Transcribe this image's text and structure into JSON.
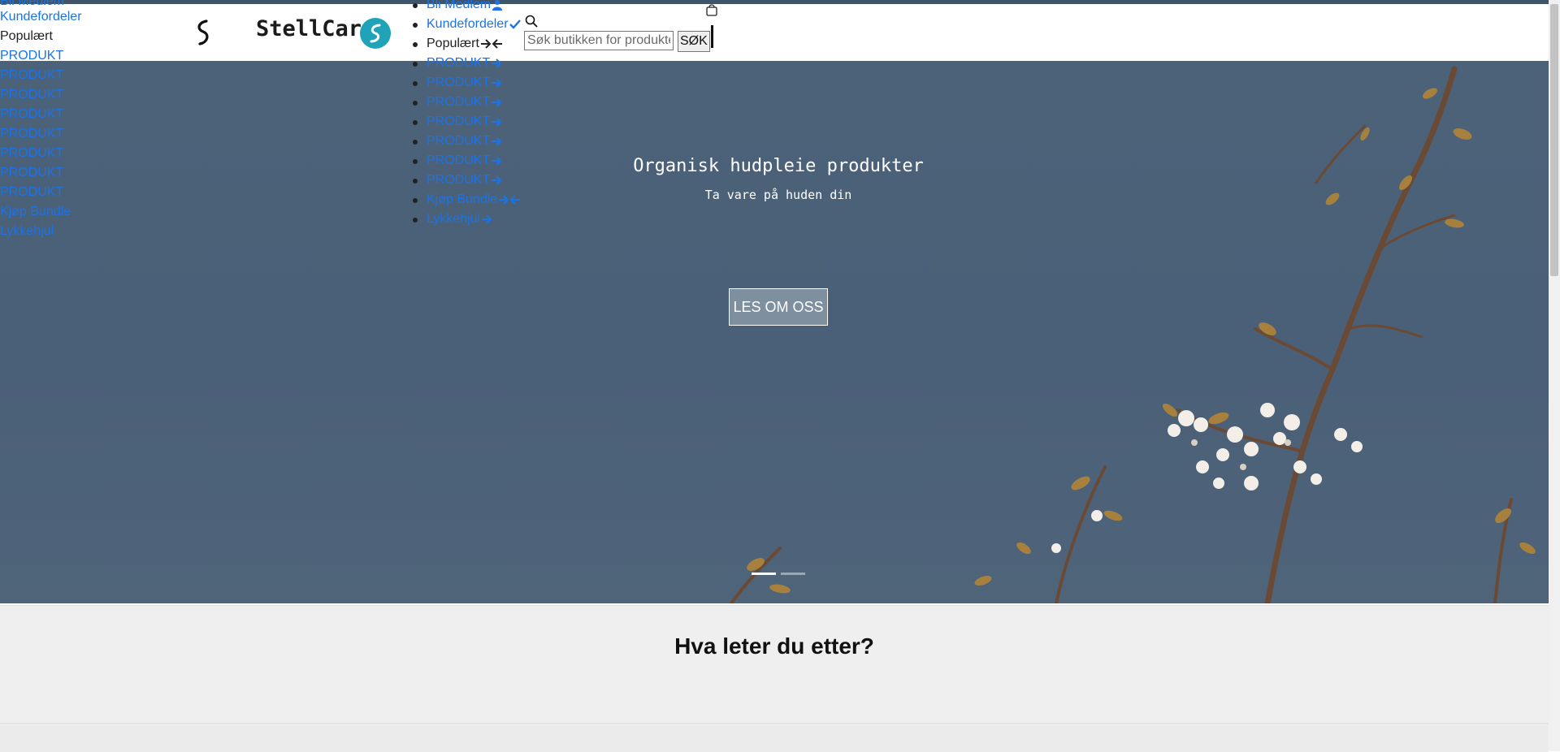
{
  "brand": {
    "name": "StellCare"
  },
  "left_links": [
    {
      "label": "Bli Medlem"
    },
    {
      "label": "Kundefordeler"
    },
    {
      "label": "Populært"
    },
    {
      "label": "PRODUKT"
    },
    {
      "label": "PRODUKT"
    },
    {
      "label": "PRODUKT"
    },
    {
      "label": "PRODUKT"
    },
    {
      "label": "PRODUKT"
    },
    {
      "label": "PRODUKT"
    },
    {
      "label": "PRODUKT"
    },
    {
      "label": "PRODUKT"
    },
    {
      "label": "Kjøp Bundle"
    },
    {
      "label": "Lykkehjul"
    }
  ],
  "nav": {
    "items": [
      {
        "label": "Bli Medlem",
        "icon": "member-icon"
      },
      {
        "label": "Kundefordeler",
        "icon": "check-icon"
      },
      {
        "label": "Populært",
        "icon": "arrows-icon"
      },
      {
        "label": "PRODUKT",
        "icon": "arrow-right-icon"
      },
      {
        "label": "PRODUKT",
        "icon": "arrow-right-icon"
      },
      {
        "label": "PRODUKT",
        "icon": "arrow-right-icon"
      },
      {
        "label": "PRODUKT",
        "icon": "arrow-right-icon"
      },
      {
        "label": "PRODUKT",
        "icon": "arrow-right-icon"
      },
      {
        "label": "PRODUKT",
        "icon": "arrow-right-icon"
      },
      {
        "label": "PRODUKT",
        "icon": "arrow-right-icon"
      },
      {
        "label": "Kjøp Bundle",
        "icon": "arrows-icon"
      },
      {
        "label": "Lykkehjul",
        "icon": "arrow-right-icon"
      }
    ]
  },
  "search": {
    "placeholder": "Søk butikken for produkter",
    "button_label": "SØK"
  },
  "hero": {
    "title": "Organisk hudpleie produkter",
    "subtitle": "Ta vare på huden din",
    "button_label": "LES OM OSS",
    "slides": 2,
    "active_slide": 1
  },
  "section": {
    "title": "Hva leter du etter?"
  },
  "colors": {
    "accent": "#1a73e8",
    "brand_teal": "#1fa3b8",
    "hero_bg": "#4b6279"
  }
}
